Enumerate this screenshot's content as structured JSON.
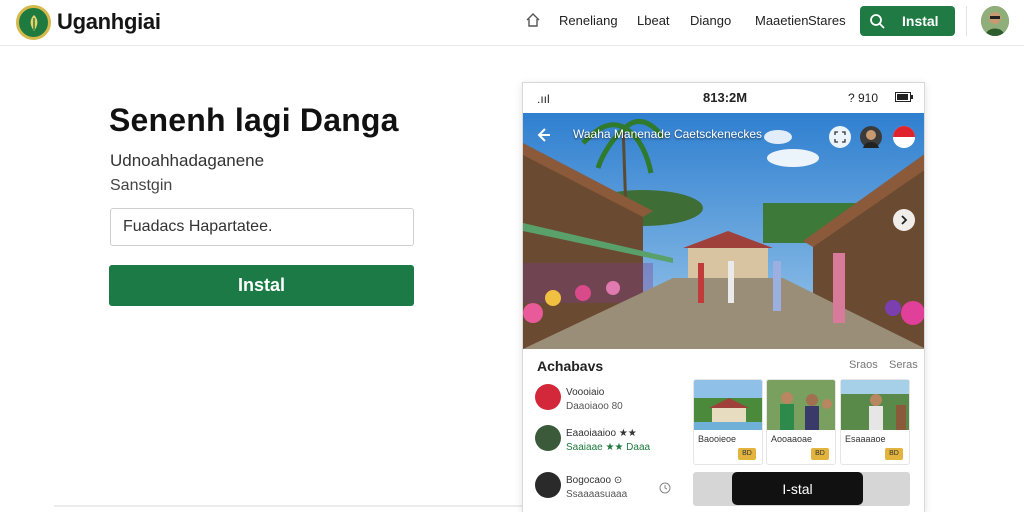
{
  "app": {
    "brand": "Uganhgiai",
    "logo_icon": "leaf-emblem-icon",
    "accent_color": "#1f7a43"
  },
  "nav": {
    "home_icon": "home-icon",
    "items": [
      "Reneliang",
      "Lbeat",
      "Diango",
      "Maaetien",
      "Stares"
    ],
    "install_label": "Instal",
    "install_icon": "search-icon"
  },
  "hero": {
    "title": "Senenh lagi Danga",
    "subtitle_line1": "Udnoahhadaganene",
    "subtitle_line2": "Sanstgin",
    "input_placeholder": "Fuadacs Hapartatee.",
    "button_label": "Instal"
  },
  "phone": {
    "status": {
      "signal": ".ııl",
      "time": "813:2M",
      "right": "? 910"
    },
    "photo": {
      "caption": "Waaha Manenade Caetsckeneckes",
      "back_icon": "arrow-left-icon",
      "expand_icon": "expand-icon",
      "next_icon": "chevron-right-icon"
    },
    "section_title": "Achabavs",
    "section_links": [
      "Sraos",
      "Seras"
    ],
    "list": [
      {
        "title": "Voooiaio",
        "meta": "Daaoiaoo 80"
      },
      {
        "title": "Eaaoiaaioo ★★",
        "meta": "Saaiaae ★★ Daaa"
      },
      {
        "title": "Bogocaoo ⊙",
        "meta": "Ssaaaasuaaa"
      }
    ],
    "cards": [
      {
        "label": "Baooieoe",
        "tag": "BD"
      },
      {
        "label": "Aooaaoae",
        "tag": "BD"
      },
      {
        "label": "Esaaaaoe",
        "tag": "BD"
      }
    ],
    "dark_button_label": "I-stal"
  }
}
